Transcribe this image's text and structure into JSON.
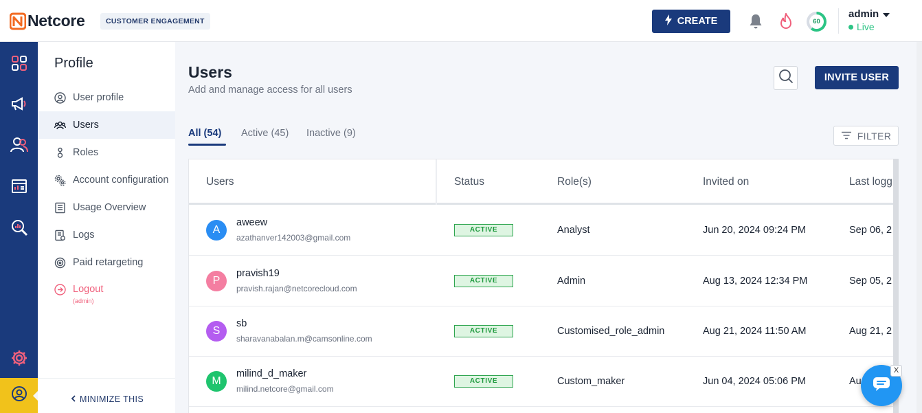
{
  "header": {
    "brand": "Netcore",
    "env_chip": "CUSTOMER ENGAGEMENT",
    "create_label": "CREATE",
    "score": "60",
    "account_name": "admin",
    "account_status": "Live"
  },
  "rail": {
    "icons": [
      "dashboard-icon",
      "megaphone-icon",
      "users-icon",
      "reports-icon",
      "analytics-icon",
      "settings-icon",
      "profile-icon"
    ]
  },
  "sidebar": {
    "title": "Profile",
    "items": [
      {
        "label": "User profile",
        "icon": "user-circle-icon"
      },
      {
        "label": "Users",
        "icon": "users-group-icon"
      },
      {
        "label": "Roles",
        "icon": "roles-icon"
      },
      {
        "label": "Account configuration",
        "icon": "gears-icon"
      },
      {
        "label": "Usage Overview",
        "icon": "document-icon"
      },
      {
        "label": "Logs",
        "icon": "logs-icon"
      },
      {
        "label": "Paid retargeting",
        "icon": "target-icon"
      }
    ],
    "logout_label": "Logout",
    "logout_sub": "(admin)",
    "minimize_label": "MINIMIZE THIS"
  },
  "main": {
    "title": "Users",
    "subtitle": "Add and manage access for all users",
    "invite_label": "INVITE USER",
    "filter_label": "FILTER",
    "tabs": [
      "All (54)",
      "Active (45)",
      "Inactive (9)"
    ],
    "columns": [
      "Users",
      "Status",
      "Role(s)",
      "Invited on",
      "Last logg"
    ],
    "rows": [
      {
        "initial": "A",
        "color": "#2a8df3",
        "name": "aweew",
        "email": "azathanver142003@gmail.com",
        "status": "ACTIVE",
        "role": "Analyst",
        "invited": "Jun 20, 2024 09:24 PM",
        "last": "Sep 06, 2"
      },
      {
        "initial": "P",
        "color": "#f47ea1",
        "name": "pravish19",
        "email": "pravish.rajan@netcorecloud.com",
        "status": "ACTIVE",
        "role": "Admin",
        "invited": "Aug 13, 2024 12:34 PM",
        "last": "Sep 05, 2"
      },
      {
        "initial": "S",
        "color": "#b45df0",
        "name": "sb",
        "email": "sharavanabalan.m@camsonline.com",
        "status": "ACTIVE",
        "role": "Customised_role_admin",
        "invited": "Aug 21, 2024 11:50 AM",
        "last": "Aug 21, 2"
      },
      {
        "initial": "M",
        "color": "#1fc46e",
        "name": "milind_d_maker",
        "email": "milind.netcore@gmail.com",
        "status": "ACTIVE",
        "role": "Custom_maker",
        "invited": "Jun 04, 2024 05:06 PM",
        "last": "Au"
      }
    ]
  },
  "chat": {
    "close_label": "X"
  }
}
